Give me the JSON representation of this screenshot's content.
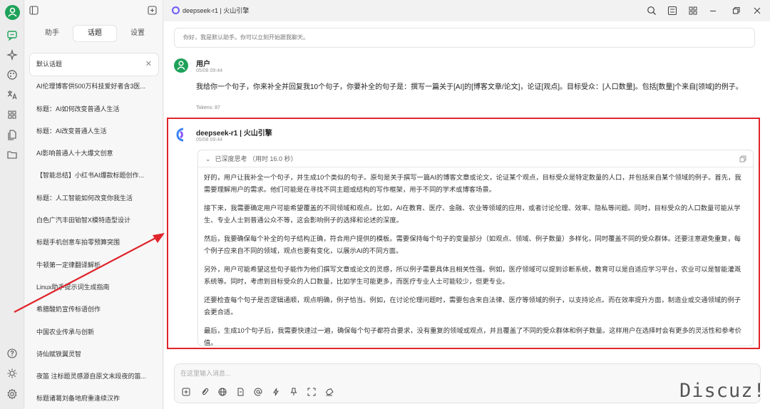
{
  "app": {
    "window_title": "deepseek-r1 | 火山引擎",
    "watermark": "Discuz!"
  },
  "panel": {
    "tabs": [
      "助手",
      "话题",
      "设置"
    ],
    "active_tab": "话题",
    "topics": [
      "默认话题",
      "AI伦理博客供500万科技爱好者含3医...",
      "标题：AI如何改变普通人生活",
      "标题：AI改变普通人生活",
      "AI影响普通人十大爆文创意",
      "【智能总结】小红书AI爆款标题创作...",
      "标题：人工智能如何改变你我生活",
      "白色广汽丰田铂智X模特造型设计",
      "标题手机创意车拍零预算突围",
      "牛顿第一定律翻译解析",
      "Linux助手提示词生成指南",
      "希腊酸奶宣传标语创作",
      "中国农业传承与创新",
      "诗仙赋铁翼灵智",
      "夜笛 注标题灵感源自原文末段夜的笛...",
      "标题诸葛刘备地府重逢续汉祚"
    ]
  },
  "chat": {
    "greeting": "你好，我是默认助手。你可以立刻开始跟我聊天。",
    "user": {
      "name": "用户",
      "time": "05/08 09:44",
      "text": "我给你一个句子，你来补全并回复我10个句子，你要补全的句子是：撰写一篇关于[AI]的[博客文章/论文]，论证[观点]。目标受众：[人口数量]。包括[数量]个来自[领域]的例子。",
      "tokens": "Tokens: 87"
    },
    "bot": {
      "name": "deepseek-r1 | 火山引擎",
      "time": "05/08 09:44",
      "think_header": "已深度思考 （用时 16.0 秒）",
      "paragraphs": [
        "好的，用户让我补全一个句子，并生成10个类似的句子。原句是关于撰写一篇AI的博客文章或论文，论证某个观点，目标受众是特定数量的人口，并包括来自某个领域的例子。首先，我需要理解用户的需求。他们可能是在寻找不同主题或结构的写作框架，用于不同的学术或博客场景。",
        "接下来，我需要确定用户可能希望覆盖的不同领域和观点。比如，AI在教育、医疗、金融、农业等领域的应用，或者讨论伦理、效率、隐私等问题。同时，目标受众的人口数量可能从学生、专业人士到普通公众不等，这会影响例子的选择和论述的深度。",
        "然后，我要确保每个补全的句子结构正确，符合用户提供的模板。需要保持每个句子的变量部分（如观点、领域、例子数量）多样化，同时覆盖不同的受众群体。还要注意避免重复，每个例子应来自不同的领域，观点也要有变化，以展示AI的不同方面。",
        "另外，用户可能希望这些句子能作为他们撰写文章或论文的灵感，所以例子需要具体且相关性强。例如，医疗领域可以提到诊断系统，教育可以是自适应学习平台，农业可以是智能灌溉系统等。同时，考虑到目标受众的人口数量，比如学生可能更多，而医疗专业人士可能较少，但更专业。",
        "还要检查每个句子是否逻辑通顺，观点明确，例子恰当。例如，在讨论伦理问题时，需要包含来自法律、医疗等领域的例子，以支持论点。而在效率提升方面，制造业或交通领域的例子会更合适。",
        "最后，生成10个句子后，我需要快速过一遍，确保每个句子都符合要求，没有重复的领域或观点，并且覆盖了不同的受众群体和例子数量。这样用户在选择时会有更多的灵活性和参考价值。"
      ]
    }
  },
  "input": {
    "placeholder": "在这里输入消息..."
  },
  "colors": {
    "accent_green": "#1ea15a",
    "highlight_red": "#e0242b"
  },
  "icons": {
    "rail": [
      "chat-icon",
      "sparkle-icon",
      "palette-icon",
      "translate-icon",
      "apps-icon",
      "files-icon",
      "folder-icon",
      "help-icon",
      "brightness-icon",
      "settings-icon"
    ],
    "topbar": [
      "search-icon",
      "layout-icon",
      "grid-icon",
      "minimize-icon",
      "maximize-icon",
      "close-icon"
    ],
    "input_toolbar": [
      "new-topic-icon",
      "attach-icon",
      "web-search-icon",
      "knowledge-icon",
      "mention-icon",
      "flash-icon",
      "pin-icon",
      "expand-icon",
      "clear-icon"
    ]
  }
}
